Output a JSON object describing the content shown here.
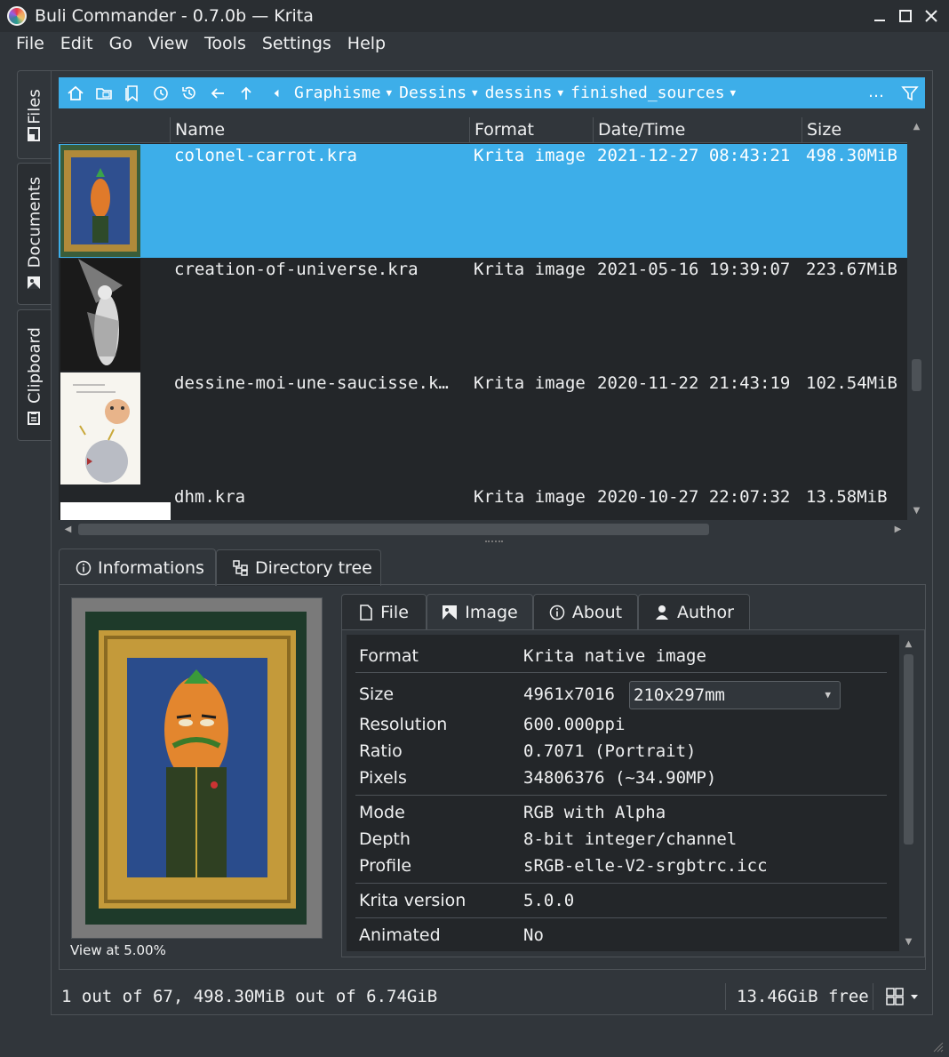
{
  "window": {
    "title": "Buli Commander - 0.7.0b — Krita",
    "minimize": "—",
    "maximize": "☐",
    "close": "✕"
  },
  "menu": [
    "File",
    "Edit",
    "Go",
    "View",
    "Tools",
    "Settings",
    "Help"
  ],
  "side_tabs": [
    "Files",
    "Documents",
    "Clipboard"
  ],
  "toolbar": {
    "breadcrumbs": [
      "Graphisme",
      "Dessins",
      "dessins",
      "finished_sources"
    ],
    "more": "…"
  },
  "table": {
    "columns": [
      "Name",
      "Format",
      "Date/Time",
      "Size"
    ],
    "rows": [
      {
        "name": "colonel-carrot.kra",
        "format": "Krita image",
        "datetime": "2021-12-27 08:43:21",
        "size": "498.30MiB",
        "selected": true
      },
      {
        "name": "creation-of-universe.kra",
        "format": "Krita image",
        "datetime": "2021-05-16 19:39:07",
        "size": "223.67MiB"
      },
      {
        "name": "dessine-moi-une-saucisse.k…",
        "format": "Krita image",
        "datetime": "2020-11-22 21:43:19",
        "size": "102.54MiB"
      },
      {
        "name": "dhm.kra",
        "format": "Krita image",
        "datetime": "2020-10-27 22:07:32",
        "size": "13.58MiB"
      }
    ]
  },
  "bottom_tabs": [
    "Informations",
    "Directory tree"
  ],
  "preview": {
    "caption": "View at 5.00%"
  },
  "info_tabs": [
    "File",
    "Image",
    "About",
    "Author"
  ],
  "properties": {
    "format": {
      "label": "Format",
      "value": "Krita native image"
    },
    "size": {
      "label": "Size",
      "value": "4961x7016",
      "unit_selected": "210x297mm"
    },
    "resolution": {
      "label": "Resolution",
      "value": "600.000ppi"
    },
    "ratio": {
      "label": "Ratio",
      "value": "0.7071 (Portrait)"
    },
    "pixels": {
      "label": "Pixels",
      "value": "34806376 (~34.90MP)"
    },
    "mode": {
      "label": "Mode",
      "value": "RGB with Alpha"
    },
    "depth": {
      "label": "Depth",
      "value": "8-bit integer/channel"
    },
    "profile": {
      "label": "Profile",
      "value": "sRGB-elle-V2-srgbtrc.icc"
    },
    "krita_version": {
      "label": "Krita version",
      "value": "5.0.0"
    },
    "animated": {
      "label": "Animated",
      "value": "No"
    }
  },
  "status": {
    "selection": "1 out of 67, 498.30MiB out of 6.74GiB",
    "free": "13.46GiB free"
  },
  "colors": {
    "accent": "#3daee9",
    "window_bg": "#31363b",
    "view_bg": "#232629"
  }
}
